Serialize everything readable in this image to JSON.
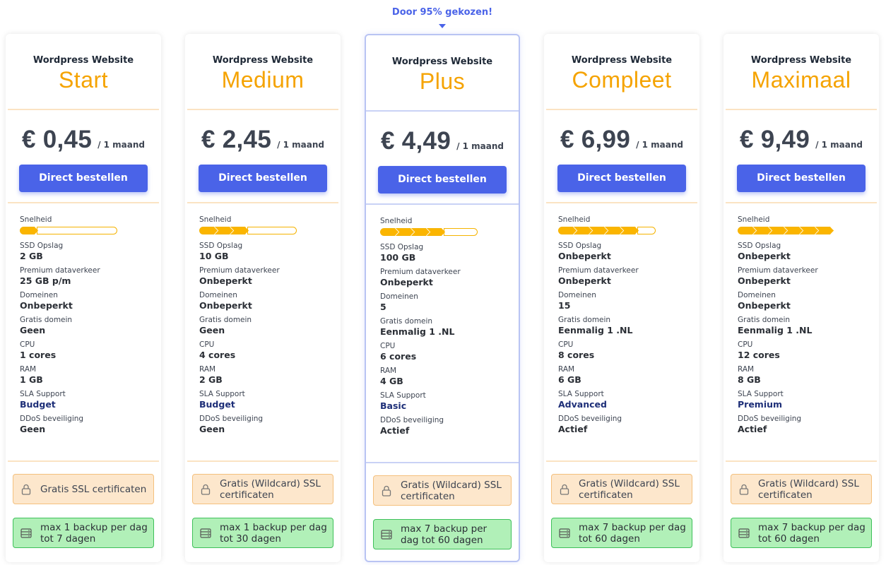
{
  "badge": {
    "text": "Door 95% gekozen!"
  },
  "colors": {
    "accent": "#4a63e8",
    "plan_name": "#f5a300",
    "ssl_bg": "#fde7cc",
    "backup_bg": "#b1f0b8"
  },
  "labels": {
    "speed": "Snelheid",
    "ssd": "SSD Opslag",
    "traffic": "Premium dataverkeer",
    "domains": "Domeinen",
    "free_domain": "Gratis domein",
    "cpu": "CPU",
    "ram": "RAM",
    "support": "SLA Support",
    "ddos": "DDoS beveiliging",
    "order": "Direct bestellen",
    "period": "/ 1 maand",
    "subtitle": "Wordpress Website"
  },
  "plans": [
    {
      "name": "Start",
      "price": "€ 0,45",
      "speed_level": 1,
      "speed_total": 6,
      "ssd": "2 GB",
      "traffic": "25 GB p/m",
      "domains": "Onbeperkt",
      "free_domain": "Geen",
      "cpu": "1 cores",
      "ram": "1 GB",
      "support": "Budget",
      "ddos": "Geen",
      "ssl": "Gratis SSL certificaten",
      "backup": "max 1 backup per dag tot 7 dagen",
      "ssl_icon": "lock-icon",
      "backup_icon": "server-icon"
    },
    {
      "name": "Medium",
      "price": "€ 2,45",
      "speed_level": 3,
      "speed_total": 6,
      "ssd": "10 GB",
      "traffic": "Onbeperkt",
      "domains": "Onbeperkt",
      "free_domain": "Geen",
      "cpu": "4 cores",
      "ram": "2 GB",
      "support": "Budget",
      "ddos": "Geen",
      "ssl": "Gratis (Wildcard) SSL certificaten",
      "backup": "max 1 backup per dag tot 30 dagen",
      "ssl_icon": "lock-icon",
      "backup_icon": "server-icon"
    },
    {
      "name": "Plus",
      "price": "€ 4,49",
      "speed_level": 4,
      "speed_total": 6,
      "ssd": "100 GB",
      "traffic": "Onbeperkt",
      "domains": "5",
      "free_domain": "Eenmalig 1 .NL",
      "cpu": "6 cores",
      "ram": "4 GB",
      "support": "Basic",
      "ddos": "Actief",
      "ssl": "Gratis (Wildcard) SSL certificaten",
      "backup": "max 7 backup per dag tot 60 dagen",
      "ssl_icon": "lock-icon",
      "backup_icon": "server-icon"
    },
    {
      "name": "Compleet",
      "price": "€ 6,99",
      "speed_level": 5,
      "speed_total": 6,
      "ssd": "Onbeperkt",
      "traffic": "Onbeperkt",
      "domains": "15",
      "free_domain": "Eenmalig 1 .NL",
      "cpu": "8 cores",
      "ram": "6 GB",
      "support": "Advanced",
      "ddos": "Actief",
      "ssl": "Gratis (Wildcard) SSL certificaten",
      "backup": "max 7 backup per dag tot 60 dagen",
      "ssl_icon": "lock-icon",
      "backup_icon": "server-icon"
    },
    {
      "name": "Maximaal",
      "price": "€ 9,49",
      "speed_level": 6,
      "speed_total": 6,
      "ssd": "Onbeperkt",
      "traffic": "Onbeperkt",
      "domains": "Onbeperkt",
      "free_domain": "Eenmalig 1 .NL",
      "cpu": "12 cores",
      "ram": "8 GB",
      "support": "Premium",
      "ddos": "Actief",
      "ssl": "Gratis (Wildcard) SSL certificaten",
      "backup": "max 7 backup per dag tot 60 dagen",
      "ssl_icon": "lock-icon",
      "backup_icon": "server-icon"
    }
  ]
}
